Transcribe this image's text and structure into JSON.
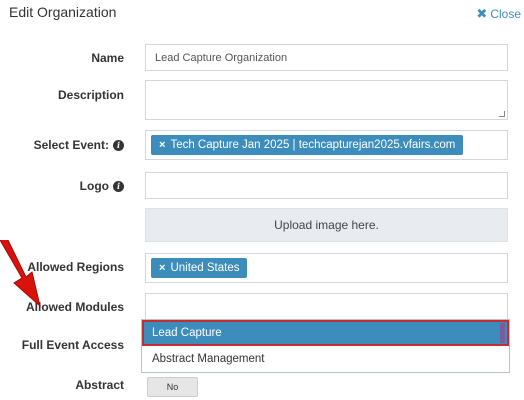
{
  "modal": {
    "title": "Edit Organization",
    "close_label": "Close"
  },
  "form": {
    "name": {
      "label": "Name",
      "value": "Lead Capture Organization"
    },
    "description": {
      "label": "Description",
      "value": ""
    },
    "select_event": {
      "label": "Select Event:",
      "tags": [
        {
          "remove": "×",
          "text": "Tech Capture Jan 2025 | techcapturejan2025.vfairs.com"
        }
      ]
    },
    "logo": {
      "label": "Logo",
      "upload_text": "Upload image here."
    },
    "allowed_regions": {
      "label": "Allowed Regions",
      "tags": [
        {
          "remove": "×",
          "text": "United States"
        }
      ]
    },
    "allowed_modules": {
      "label": "Allowed Modules",
      "options": [
        {
          "text": "Lead Capture",
          "highlighted": true
        },
        {
          "text": "Abstract Management",
          "highlighted": false
        }
      ]
    },
    "full_event_access": {
      "label": "Full Event Access"
    },
    "abstract": {
      "label": "Abstract",
      "toggle": "No"
    }
  },
  "colors": {
    "accent": "#3c8dbc",
    "annotation_arrow": "#d9120b",
    "highlight_border": "#c03030"
  }
}
